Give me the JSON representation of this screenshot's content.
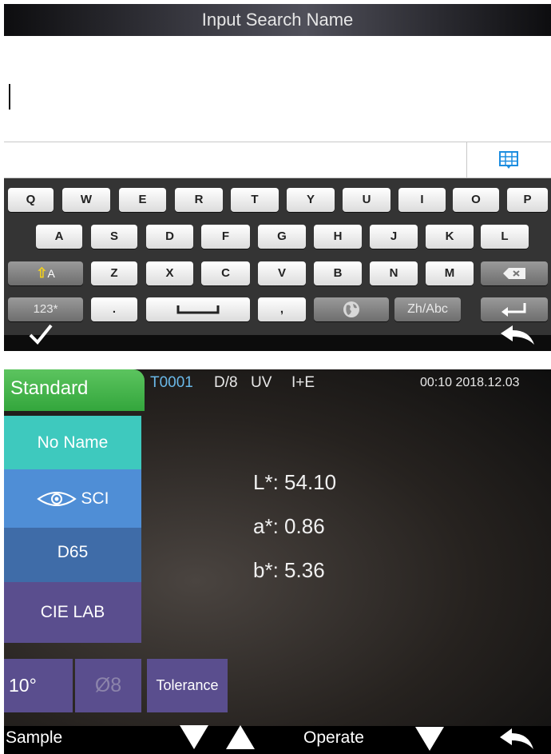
{
  "keyboard_screen": {
    "title": "Input Search Name",
    "rows": [
      [
        "Q",
        "W",
        "E",
        "R",
        "T",
        "Y",
        "U",
        "I",
        "O",
        "P"
      ],
      [
        "A",
        "S",
        "D",
        "F",
        "G",
        "H",
        "J",
        "K",
        "L"
      ],
      [
        "Z",
        "X",
        "C",
        "V",
        "B",
        "N",
        "M"
      ]
    ],
    "shift_label": "A",
    "numbers_label": "123*",
    "period_label": ".",
    "comma_label": ",",
    "lang_label": "Zh/Abc"
  },
  "measure_screen": {
    "mode_tab": "Standard",
    "status": {
      "id": "T0001",
      "geometry": "D/8",
      "uv": "UV",
      "spec": "I+E",
      "datetime": "00:10 2018.12.03"
    },
    "sidebar": {
      "name": "No Name",
      "mode": "SCI",
      "illuminant": "D65",
      "space": "CIE LAB",
      "observer": "10°",
      "aperture": "Ø8",
      "tolerance": "Tolerance"
    },
    "readings": [
      {
        "label": "L*:",
        "value": "54.10"
      },
      {
        "label": "a*:",
        "value": "0.86"
      },
      {
        "label": "b*:",
        "value": "5.36"
      }
    ],
    "bottom": {
      "sample": "Sample",
      "operate": "Operate"
    }
  },
  "colors": {
    "accent_green": "#3fae48",
    "teal": "#3ec9be",
    "blue": "#4f8ed6",
    "steel_blue": "#3f6ca8",
    "purple": "#5a4e8e",
    "status_blue": "#6ab8e8"
  }
}
